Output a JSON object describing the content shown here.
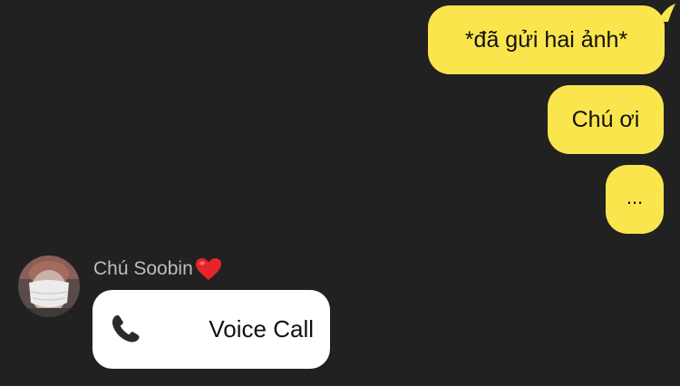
{
  "outgoing_messages": [
    {
      "text": "*đã gửi hai ảnh*"
    },
    {
      "text": "Chú ơi"
    },
    {
      "text": "..."
    }
  ],
  "incoming": {
    "sender_name": "Chú Soobin",
    "sender_emoji": "heart-emoji",
    "call_label": "Voice Call",
    "call_icon": "phone-icon"
  },
  "colors": {
    "background": "#212121",
    "outgoing_bubble": "#FBE54D",
    "incoming_bubble": "#FFFFFF",
    "sender_name": "#BDBDBD",
    "heart": "#E8242B"
  }
}
